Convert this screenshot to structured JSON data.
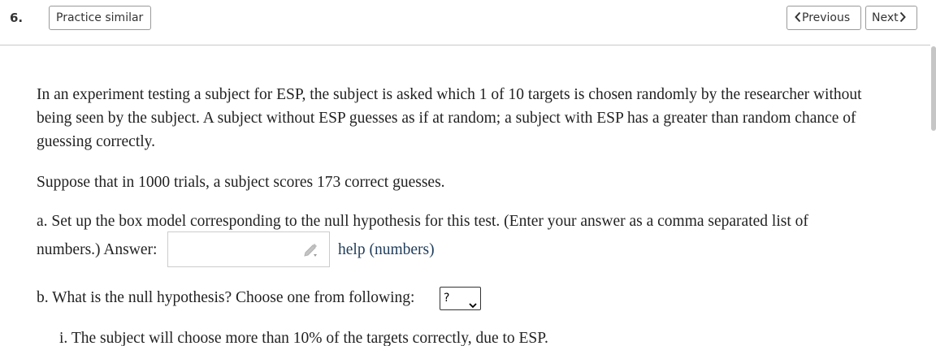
{
  "header": {
    "question_number": "6.",
    "practice_label": "Practice similar",
    "previous_label": "Previous",
    "next_label": "Next"
  },
  "question": {
    "intro": "In an experiment testing a subject for ESP, the subject is asked which 1 of 10 targets is chosen randomly by the researcher without being seen by the subject. A subject without ESP guesses as if at random; a subject with ESP has a greater than random chance of guessing correctly.",
    "setup": "Suppose that in 1000 trials, a subject scores 173 correct guesses.",
    "part_a_line1": "a. Set up the box model corresponding to the null hypothesis for this test. (Enter your answer as a comma separated list of",
    "part_a_line2": "numbers.) Answer:",
    "part_a_answer_value": "",
    "help_link": "help (numbers)",
    "part_b_prompt": "b. What is the null hypothesis? Choose one from following:",
    "part_b_selected": "?",
    "option_i": "i. The subject will choose more than 10% of the targets correctly, due to ESP."
  },
  "colors": {
    "link": "#1f3c5a",
    "border": "#9a9a9a",
    "divider": "#c8c8c8"
  },
  "icons": {
    "previous": "chevron-left-icon",
    "next": "chevron-right-icon",
    "answer_edit": "pencil-icon",
    "select": "chevron-down-icon"
  }
}
